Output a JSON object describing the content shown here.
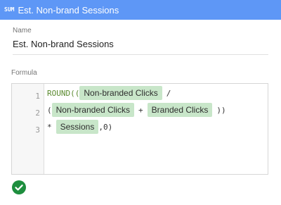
{
  "header": {
    "icon_label": "SUM",
    "title": "Est. Non-brand Sessions",
    "background_color": "#5e97f6"
  },
  "name_field": {
    "label": "Name",
    "value": "Est. Non-brand Sessions"
  },
  "formula": {
    "label": "Formula",
    "line_numbers": [
      "1",
      "2",
      "3"
    ],
    "line1": {
      "fn": "ROUND((",
      "field1": "Non-branded Clicks",
      "op": "/"
    },
    "line2": {
      "open": "(",
      "field1": "Non-branded Clicks",
      "op": "+",
      "field2": "Branded Clicks",
      "close": "))"
    },
    "line3": {
      "op": "*",
      "field1": "Sessions",
      "tail": ",0)"
    },
    "chip_color": "#c8e6c9"
  },
  "status": {
    "icon": "check-circle-icon",
    "color": "#1e8e3e"
  }
}
